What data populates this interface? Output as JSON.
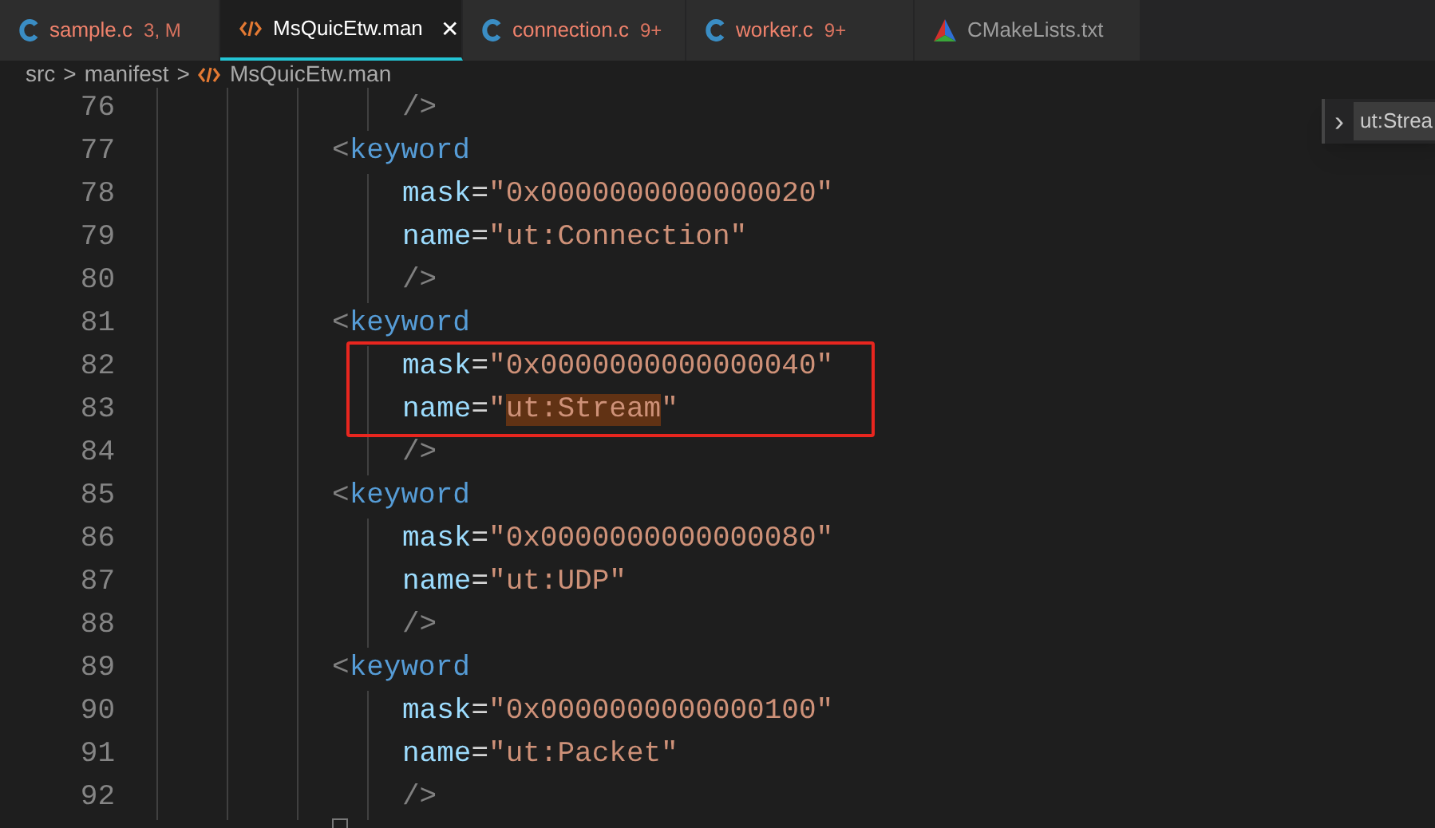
{
  "tabs": [
    {
      "kind": "c",
      "label": "sample.c",
      "badge": "3, M",
      "problems": true,
      "selected": false
    },
    {
      "kind": "xml",
      "label": "MsQuicEtw.man",
      "close": "✕",
      "problems": false,
      "selected": true
    },
    {
      "kind": "c",
      "label": "connection.c",
      "badge": "9+",
      "problems": true,
      "selected": false
    },
    {
      "kind": "c",
      "label": "worker.c",
      "badge": "9+",
      "problems": true,
      "selected": false
    },
    {
      "kind": "cmake",
      "label": "CMakeLists.txt",
      "problems": false,
      "selected": false
    }
  ],
  "breadcrumb": [
    {
      "kind": "folder",
      "label": "src"
    },
    {
      "kind": "separator",
      "label": ">"
    },
    {
      "kind": "folder",
      "label": "manifest"
    },
    {
      "kind": "separator",
      "label": ">"
    },
    {
      "kind": "xml",
      "label": "MsQuicEtw.man"
    }
  ],
  "find_widget": {
    "toggle": "›",
    "value": "ut:Strea"
  },
  "lines": [
    {
      "number": "76",
      "kind": "attr",
      "tokens": [
        {
          "kind": "punct",
          "text": "/>"
        }
      ]
    },
    {
      "number": "77",
      "kind": "tag",
      "tokens": [
        {
          "kind": "punct",
          "text": "<"
        },
        {
          "kind": "tag",
          "text": "keyword"
        }
      ]
    },
    {
      "number": "78",
      "kind": "attr",
      "tokens": [
        {
          "kind": "attr",
          "text": "mask"
        },
        {
          "kind": "op",
          "text": "="
        },
        {
          "kind": "string",
          "text": "\"0x0000000000000020\""
        }
      ]
    },
    {
      "number": "79",
      "kind": "attr",
      "tokens": [
        {
          "kind": "attr",
          "text": "name"
        },
        {
          "kind": "op",
          "text": "="
        },
        {
          "kind": "string",
          "text": "\"ut:Connection\""
        }
      ]
    },
    {
      "number": "80",
      "kind": "attr",
      "tokens": [
        {
          "kind": "punct",
          "text": "/>"
        }
      ]
    },
    {
      "number": "81",
      "kind": "tag",
      "tokens": [
        {
          "kind": "punct",
          "text": "<"
        },
        {
          "kind": "tag",
          "text": "keyword"
        }
      ]
    },
    {
      "number": "82",
      "kind": "attr",
      "boxed": true,
      "tokens": [
        {
          "kind": "attr",
          "text": "mask"
        },
        {
          "kind": "op",
          "text": "="
        },
        {
          "kind": "string",
          "text": "\"0x0000000000000040\""
        }
      ]
    },
    {
      "number": "83",
      "kind": "attr",
      "boxed": true,
      "tokens": [
        {
          "kind": "attr",
          "text": "name"
        },
        {
          "kind": "op",
          "text": "="
        },
        {
          "kind": "string",
          "text": "\""
        },
        {
          "kind": "match",
          "text": "ut:Stream"
        },
        {
          "kind": "string",
          "text": "\""
        }
      ]
    },
    {
      "number": "84",
      "kind": "attr",
      "tokens": [
        {
          "kind": "punct",
          "text": "/>"
        }
      ]
    },
    {
      "number": "85",
      "kind": "tag",
      "tokens": [
        {
          "kind": "punct",
          "text": "<"
        },
        {
          "kind": "tag",
          "text": "keyword"
        }
      ]
    },
    {
      "number": "86",
      "kind": "attr",
      "tokens": [
        {
          "kind": "attr",
          "text": "mask"
        },
        {
          "kind": "op",
          "text": "="
        },
        {
          "kind": "string",
          "text": "\"0x0000000000000080\""
        }
      ]
    },
    {
      "number": "87",
      "kind": "attr",
      "tokens": [
        {
          "kind": "attr",
          "text": "name"
        },
        {
          "kind": "op",
          "text": "="
        },
        {
          "kind": "string",
          "text": "\"ut:UDP\""
        }
      ]
    },
    {
      "number": "88",
      "kind": "attr",
      "tokens": [
        {
          "kind": "punct",
          "text": "/>"
        }
      ]
    },
    {
      "number": "89",
      "kind": "tag",
      "tokens": [
        {
          "kind": "punct",
          "text": "<"
        },
        {
          "kind": "tag",
          "text": "keyword"
        }
      ]
    },
    {
      "number": "90",
      "kind": "attr",
      "tokens": [
        {
          "kind": "attr",
          "text": "mask"
        },
        {
          "kind": "op",
          "text": "="
        },
        {
          "kind": "string",
          "text": "\"0x0000000000000100\""
        }
      ]
    },
    {
      "number": "91",
      "kind": "attr",
      "tokens": [
        {
          "kind": "attr",
          "text": "name"
        },
        {
          "kind": "op",
          "text": "="
        },
        {
          "kind": "string",
          "text": "\"ut:Packet\""
        }
      ]
    },
    {
      "number": "92",
      "kind": "attr",
      "tokens": [
        {
          "kind": "punct",
          "text": "/>"
        }
      ]
    }
  ]
}
